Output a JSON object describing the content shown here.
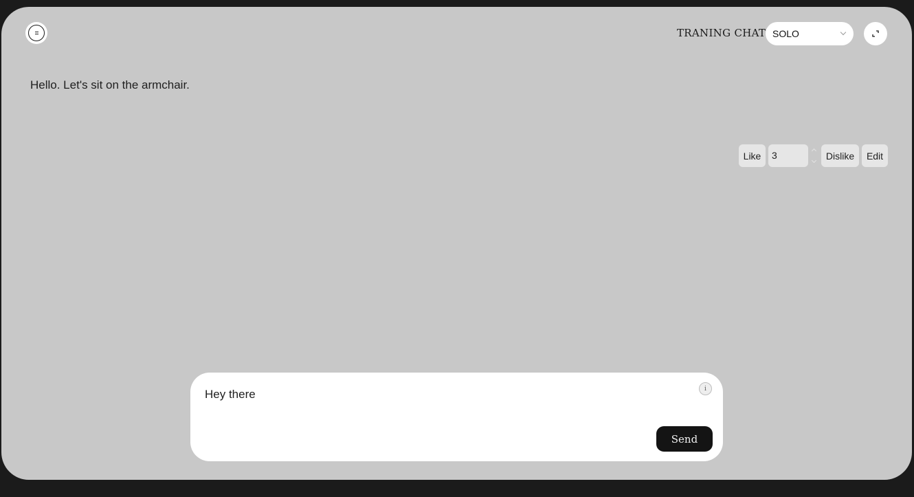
{
  "header": {
    "title": "TRANING CHAT",
    "mode_select": {
      "value": "SOLO"
    }
  },
  "conversation": {
    "message": "Hello. Let's sit on the armchair.",
    "actions": {
      "like_label": "Like",
      "rating_value": "3",
      "dislike_label": "Dislike",
      "edit_label": "Edit"
    }
  },
  "composer": {
    "text": "Hey there",
    "info_glyph": "i",
    "send_label": "Send"
  },
  "icons": {
    "menu": "menu-icon",
    "expand": "expand-icon",
    "chevron": "chevron-down-icon",
    "info": "info-icon"
  },
  "colors": {
    "page_background": "#1b1b1b",
    "frame_background": "#c8c8c8",
    "send_button": "#141414",
    "action_button": "#e6e6e6"
  }
}
